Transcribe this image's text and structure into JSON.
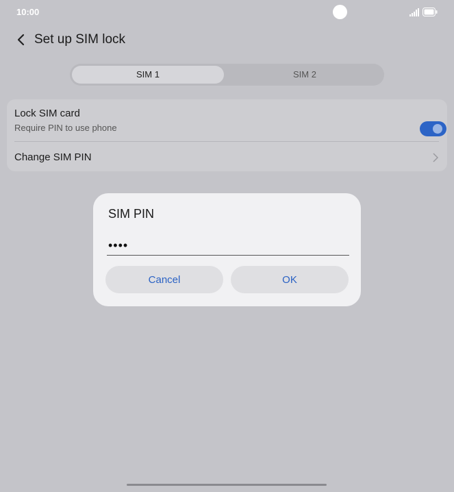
{
  "status_bar": {
    "time": "10:00"
  },
  "header": {
    "title": "Set up SIM lock"
  },
  "tabs": [
    {
      "label": "SIM 1",
      "selected": true
    },
    {
      "label": "SIM 2",
      "selected": false
    }
  ],
  "settings": {
    "lock_sim": {
      "label": "Lock SIM card",
      "sublabel": "Require PIN to use phone",
      "enabled": true
    },
    "change_pin": {
      "label": "Change SIM PIN"
    }
  },
  "dialog": {
    "title": "SIM PIN",
    "pin_value": "••••",
    "cancel_label": "Cancel",
    "ok_label": "OK"
  },
  "colors": {
    "accent": "#2c64c6",
    "background": "#c4c4c9",
    "dialog": "#f1f1f3"
  }
}
